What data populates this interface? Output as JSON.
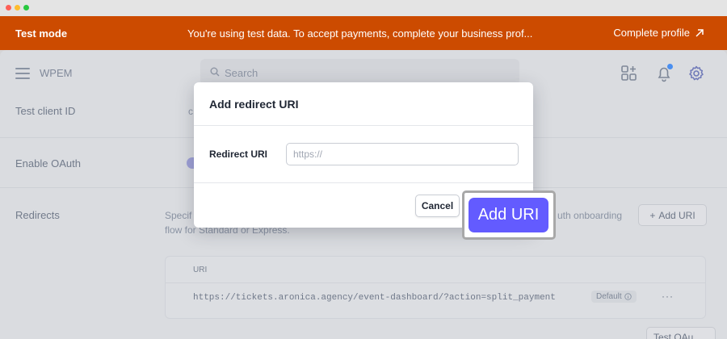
{
  "banner": {
    "mode_label": "Test mode",
    "message": "You're using test data. To accept payments, complete your business prof...",
    "cta_label": "Complete profile"
  },
  "header": {
    "app_name": "WPEM",
    "search_placeholder": "Search"
  },
  "settings": {
    "client_id_label": "Test client ID",
    "client_id_value_truncated": "c",
    "oauth_label": "Enable OAuth",
    "redirects_label": "Redirects",
    "redirects_description_start": "Specif",
    "redirects_description_tail": "uth onboarding",
    "redirects_description_line2": "flow for Standard or Express.",
    "add_uri_side_label": "Add URI",
    "uri_table": {
      "column_header": "URI",
      "rows": [
        {
          "uri": "https://tickets.aronica.agency/event-dashboard/?action=split_payment",
          "badge": "Default"
        }
      ],
      "more_label": "···"
    },
    "test_oauth_label": "Test OAu"
  },
  "modal": {
    "title": "Add redirect URI",
    "field_label": "Redirect URI",
    "field_placeholder": "https://",
    "field_value": "",
    "cancel_label": "Cancel",
    "submit_label": "Add URI"
  },
  "colors": {
    "banner_bg": "#cc4b00",
    "primary": "#635bff",
    "notify_dot": "#4a8ff0"
  }
}
